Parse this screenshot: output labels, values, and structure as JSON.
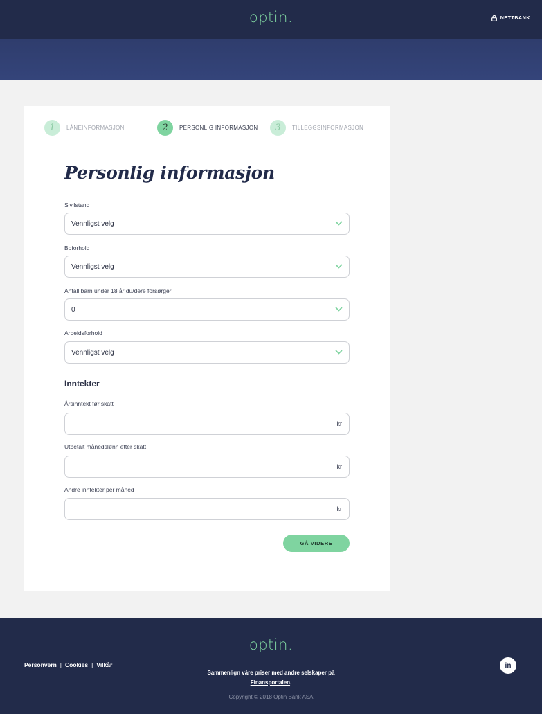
{
  "header": {
    "logo_text": "optin",
    "logo_dot": ".",
    "nettbank_label": "NETTBANK",
    "nettbank_icon": "lock-icon"
  },
  "steps": [
    {
      "number": "1",
      "label": "LÅNEINFORMASJON",
      "state": "inactive"
    },
    {
      "number": "2",
      "label": "PERSONLIG INFORMASJON",
      "state": "active"
    },
    {
      "number": "3",
      "label": "TILLEGGSINFORMASJON",
      "state": "inactive"
    }
  ],
  "form": {
    "title": "Personlig informasjon",
    "sivilstand": {
      "label": "Sivilstand",
      "value": "Vennligst velg"
    },
    "boforhold": {
      "label": "Boforhold",
      "value": "Vennligst velg"
    },
    "barn": {
      "label": "Antall barn under 18 år du/dere forsørger",
      "value": "0"
    },
    "arbeidsforhold": {
      "label": "Arbeidsforhold",
      "value": "Vennligst velg"
    },
    "income_heading": "Inntekter",
    "arsinntekt": {
      "label": "Årsinntekt før skatt",
      "value": "",
      "unit": "kr"
    },
    "manedslonn": {
      "label": "Utbetalt månedslønn etter skatt",
      "value": "",
      "unit": "kr"
    },
    "andre": {
      "label": "Andre inntekter per måned",
      "value": "",
      "unit": "kr"
    },
    "submit_label": "GÅ VIDERE"
  },
  "footer": {
    "logo_text": "optin",
    "logo_dot": ".",
    "links": [
      "Personvern",
      "Cookies",
      "Vilkår"
    ],
    "separator": "|",
    "compare_text": "Sammenlign våre priser med andre selskaper på",
    "compare_link": "Finansportalen",
    "compare_end": ".",
    "copyright": "Copyright © 2018 Optin Bank ASA",
    "social_label": "in",
    "social_icon": "linkedin-icon"
  },
  "colors": {
    "navy": "#222b4a",
    "banner": "#34447a",
    "accent_green": "#7fd4a0",
    "light_green": "#c9edd8"
  }
}
